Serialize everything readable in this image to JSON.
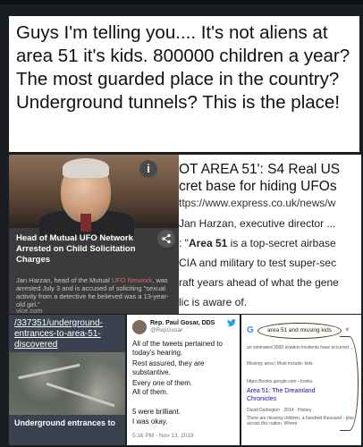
{
  "headline": "Guys I'm telling you.... It's not aliens at area 51 it's kids. 800000 children a year? The most guarded place in the country? Underground tunnels? This is the place!",
  "left_card": {
    "info": "i",
    "caption": "Head of Mutual UFO Network Arrested on Child Solicitation Charges",
    "body_lead": "Jan Harzan, head of the Mutual ",
    "body_highlight": "UFO Network",
    "body_rest": ", was arrested July 3 and is accused of soliciting \"sexual activity from a detective he believed was a 13-year-old girl.\"",
    "source": "vice.com"
  },
  "express_card": {
    "title_line1": "OT AREA 51': S4 Real US",
    "title_line2": "cret base for hiding UFOs",
    "url": "ttps://www.express.co.uk/news/w",
    "line1": "Jan Harzan, executive director ...",
    "line2_prefix": ": \"",
    "line2_bold": "Area 51",
    "line2_suffix": " is a top-secret airbase",
    "line3": "CIA and military to test super-sec",
    "line4": "raft years ahead of what the gene",
    "line5": "lic is aware of."
  },
  "map_card": {
    "link": "/337351/underground-entrances-to-area-51-discovered",
    "caption": "Underground entrances to"
  },
  "tweet": {
    "name": "Rep. Paul Gosar, DDS",
    "handle": "@RepGosar",
    "p1": "All of the tweets pertained to today's hearing.",
    "p2": "Rest assured, they are substantive.",
    "p3": "Every one of them.",
    "p4": "All of them.",
    "p5": "5 were brilliant.",
    "p6": "I was okay.",
    "time": "5:16 PM · Nov 13, 2019"
  },
  "search_card": {
    "logo": "G",
    "query": "area 51 and missing kids",
    "close": "×",
    "snippet1": "an estimated 3000 aviation incidents have occurred ...",
    "snippet2": "Missing: area | Must include: kids",
    "site": "https://books.google.com › books",
    "result_title1": "Area 51: The Dreamland",
    "result_title2": "Chronicles",
    "meta": "David Darlington · 2014 · History",
    "snippet3": "There are missing children, a hundred thousand - plus across this nation. Where"
  },
  "colors": {
    "background": "#1a1d22",
    "highlight_red": "#d46a6a",
    "twitter_blue": "#1da1f2",
    "link_blue": "#1a0dab",
    "circle_annotation": "#5a3a1a"
  }
}
